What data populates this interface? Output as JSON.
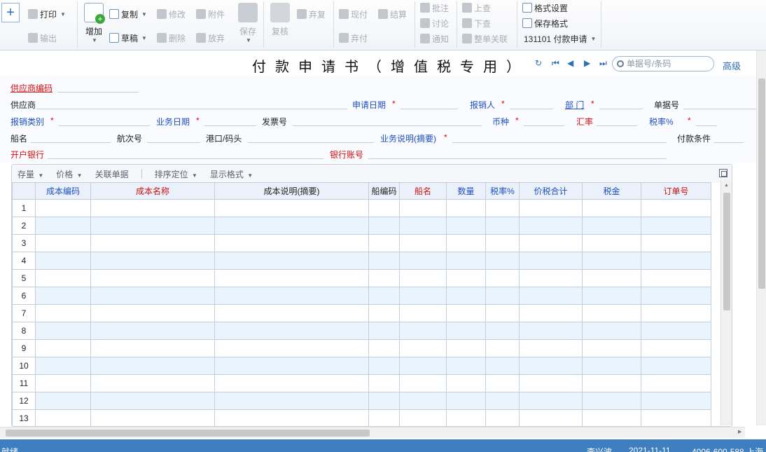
{
  "toolbar": {
    "new_symbol": "+",
    "print": "打印",
    "export": "输出",
    "add": "增加",
    "copy": "复制",
    "modify": "修改",
    "attachment": "附件",
    "draft": "草稿",
    "delete": "删除",
    "discard": "放弃",
    "save": "保存",
    "review": "复核",
    "abandon_review": "弃复",
    "cash_pay": "现付",
    "settle": "结算",
    "abandon_pay": "弃付",
    "annotate": "批注",
    "discuss": "讨论",
    "notify": "通知",
    "prev_lookup": "上查",
    "next_lookup": "下查",
    "whole_link": "整单关联",
    "format_setting": "格式设置",
    "save_format": "保存格式",
    "template_select": "131101 付款申请"
  },
  "title": "付款申请书（增值税专用）",
  "search": {
    "placeholder": "单据号/条码"
  },
  "advanced": "高级",
  "header_fields": {
    "supplier_code": "供应商编码",
    "supplier": "供应商",
    "apply_date": "申请日期",
    "reimburser": "报销人",
    "department": "部 门",
    "doc_no": "单据号",
    "reimburse_type": "报销类别",
    "biz_date": "业务日期",
    "invoice_no": "发票号",
    "currency": "币种",
    "exchange_rate": "汇率",
    "tax_rate": "税率%",
    "ship_name": "船名",
    "voyage_no": "航次号",
    "port": "港口/码头",
    "biz_desc": "业务说明(摘要)",
    "pay_terms": "付款条件",
    "bank": "开户银行",
    "bank_account": "银行账号",
    "required_mark": "*"
  },
  "grid_toolbar": {
    "stock": "存量",
    "price": "价格",
    "linked_docs": "关联单据",
    "sort_locate": "排序定位",
    "display_format": "显示格式"
  },
  "grid": {
    "columns": [
      "成本编码",
      "成本名称",
      "成本说明(摘要)",
      "船编码",
      "船名",
      "数量",
      "税率%",
      "价税合计",
      "税金",
      "订单号"
    ],
    "rows": [
      "1",
      "2",
      "3",
      "4",
      "5",
      "6",
      "7",
      "8",
      "9",
      "10",
      "11",
      "12",
      "13"
    ]
  },
  "status": {
    "ready": "就绪",
    "user": "李兴波",
    "date": "2021-11-11",
    "contact": "4006-600-588 上海"
  },
  "colors": {
    "label_blue": "#1e4fbf",
    "label_red": "#d01010",
    "status_bar": "#3d7fc1",
    "grid_header": "#eaf1fb",
    "grid_alt_row": "#eaf4fd"
  }
}
